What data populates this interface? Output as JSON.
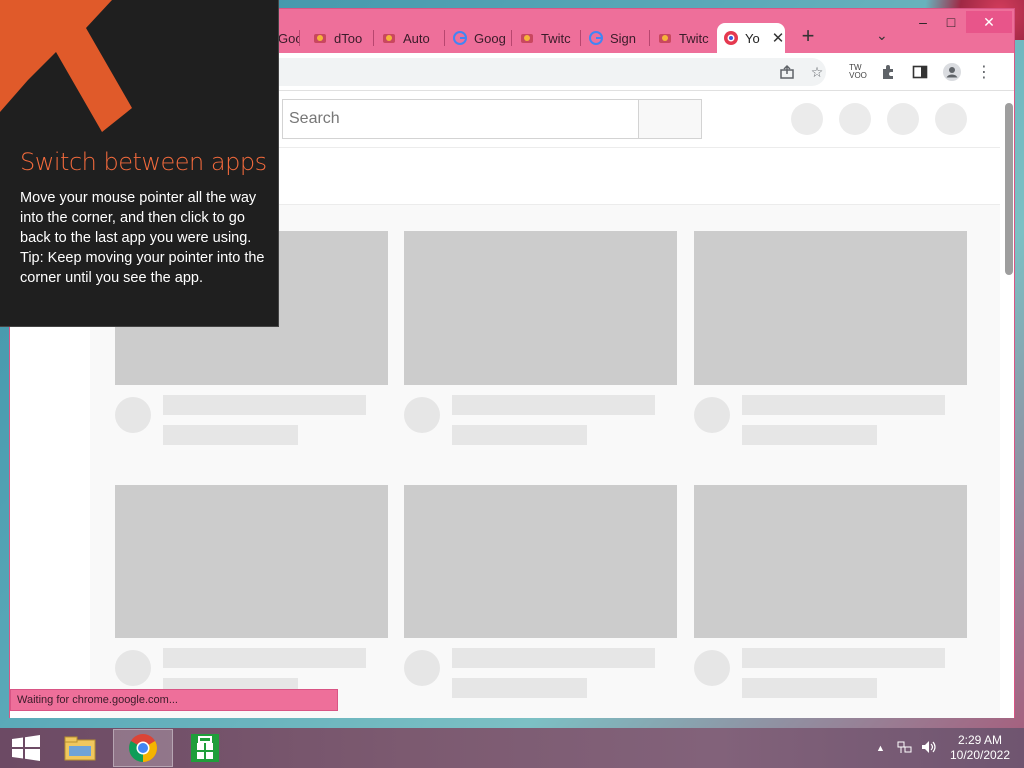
{
  "browser": {
    "tabs": [
      {
        "label": "Goo",
        "icon": "generic-favicon"
      },
      {
        "label": "dToo",
        "icon": "generic-favicon"
      },
      {
        "label": "Auto",
        "icon": "generic-favicon"
      },
      {
        "label": "Goog",
        "icon": "google-favicon"
      },
      {
        "label": "Twitc",
        "icon": "generic-favicon"
      },
      {
        "label": "Sign",
        "icon": "google-favicon"
      },
      {
        "label": "Twitc",
        "icon": "generic-favicon"
      },
      {
        "label": "Yo",
        "icon": "active-favicon",
        "active": true
      }
    ],
    "new_tab": "+",
    "tab_search": "⌄",
    "window_controls": {
      "minimize": "–",
      "maximize": "□",
      "close": "✕"
    },
    "extension_badge": "TW\nVOO",
    "status_text": "Waiting for chrome.google.com..."
  },
  "youtube": {
    "search_placeholder": "Search"
  },
  "tip": {
    "title": "Switch between apps",
    "body_line1": "Move your mouse pointer all the way into the corner, and then click to go back to the last app you were using.",
    "body_line2": "Tip: Keep moving your pointer into the corner until you see the app."
  },
  "taskbar": {
    "time": "2:29 AM",
    "date": "10/20/2022",
    "apps": [
      "file-explorer-icon",
      "chrome-icon",
      "store-icon"
    ]
  },
  "colors": {
    "window_frame": "#ee6f9a",
    "tip_accent": "#f36a3c",
    "tip_bg": "#1f1f1f"
  }
}
